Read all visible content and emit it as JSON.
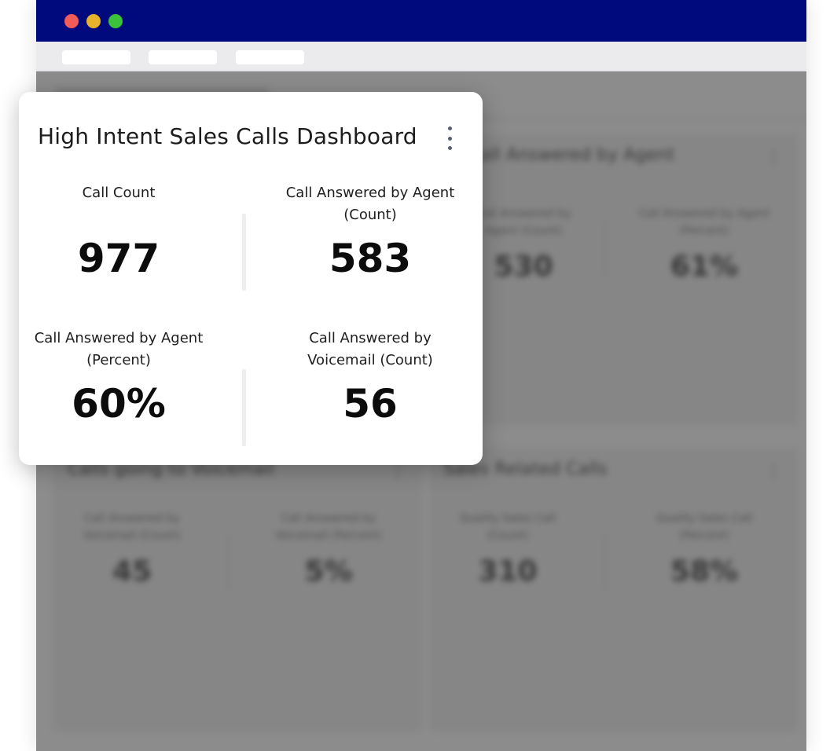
{
  "dashboard": {
    "title": "High Intent Sales Calls Dashboard",
    "menu_icon": "kebab-menu-icon",
    "metrics": [
      {
        "label": "Call Count",
        "value": "977"
      },
      {
        "label": "Call Answered by Agent\n(Count)",
        "value": "583"
      },
      {
        "label": "Call Answered by Agent\n(Percent)",
        "value": "60%"
      },
      {
        "label": "Call Answered by\nVoicemail (Count)",
        "value": "56"
      }
    ]
  },
  "background": {
    "cards": [
      {
        "title": "Call Answered by Agent",
        "metrics": [
          {
            "label": "Call Answered by\nAgent (Count)",
            "value": "530"
          },
          {
            "label": "Call Answered by Agent\n(Percent)",
            "value": "61%"
          }
        ]
      },
      {
        "title": "Calls going to Voicemail",
        "metrics": [
          {
            "label": "Call Answered by\nVoicemail (Count)",
            "value": "45"
          },
          {
            "label": "Call Answered by\nVoicemail (Percent)",
            "value": "5%"
          }
        ]
      },
      {
        "title": "Sales Related Calls",
        "metrics": [
          {
            "label": "Quality Sales Call\n(Count)",
            "value": "310"
          },
          {
            "label": "Quality Sales Call\n(Percent)",
            "value": "58%"
          }
        ]
      }
    ]
  },
  "colors": {
    "titlebar": "#010a7c",
    "window_close": "#f25b57",
    "window_minimize": "#e8b22a",
    "window_maximize": "#3cc23a"
  }
}
